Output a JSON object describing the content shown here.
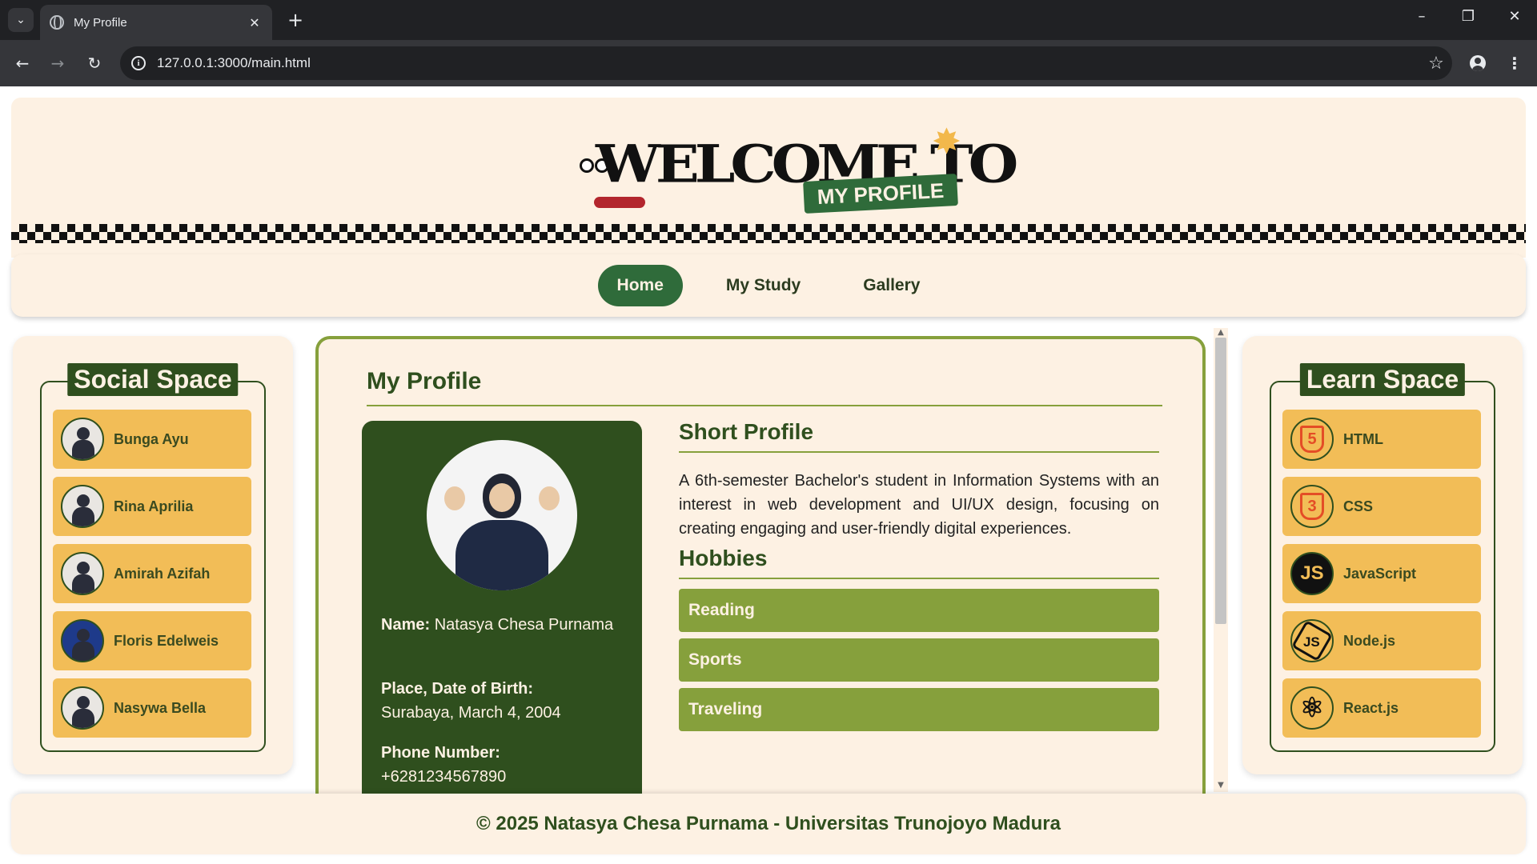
{
  "browser": {
    "tab_title": "My Profile",
    "url": "127.0.0.1:3000/main.html"
  },
  "banner": {
    "logo_text": "WELCOME TO",
    "logo_badge": "MY PROFILE"
  },
  "nav": {
    "items": [
      {
        "label": "Home",
        "active": true
      },
      {
        "label": "My Study",
        "active": false
      },
      {
        "label": "Gallery",
        "active": false
      }
    ]
  },
  "social": {
    "title": "Social Space",
    "items": [
      {
        "label": "Bunga Ayu"
      },
      {
        "label": "Rina Aprilia"
      },
      {
        "label": "Amirah Azifah"
      },
      {
        "label": "Floris Edelweis"
      },
      {
        "label": "Nasywa Bella"
      }
    ]
  },
  "learn": {
    "title": "Learn Space",
    "items": [
      {
        "label": "HTML",
        "icon": "html5-icon"
      },
      {
        "label": "CSS",
        "icon": "css3-icon"
      },
      {
        "label": "JavaScript",
        "icon": "javascript-icon"
      },
      {
        "label": "Node.js",
        "icon": "nodejs-icon"
      },
      {
        "label": "React.js",
        "icon": "react-icon"
      }
    ]
  },
  "main": {
    "title": "My Profile",
    "profile": {
      "name_label": "Name:",
      "name_value": "Natasya Chesa Purnama",
      "birth_label": "Place, Date of Birth:",
      "birth_value": "Surabaya, March 4, 2004",
      "phone_label": "Phone Number:",
      "phone_value": "+6281234567890"
    },
    "short_profile": {
      "title": "Short Profile",
      "text": "A 6th-semester Bachelor's student in Information Systems with an interest in web development and UI/UX design, focusing on creating engaging and user-friendly digital experiences."
    },
    "hobbies": {
      "title": "Hobbies",
      "items": [
        "Reading",
        "Sports",
        "Traveling"
      ]
    }
  },
  "footer": {
    "text": "© 2025 Natasya Chesa Purnama - Universitas Trunojoyo Madura"
  },
  "colors": {
    "dark_green": "#2f4f1e",
    "olive": "#86a03c",
    "cream": "#fdf1e3",
    "mustard": "#f2bd57"
  }
}
